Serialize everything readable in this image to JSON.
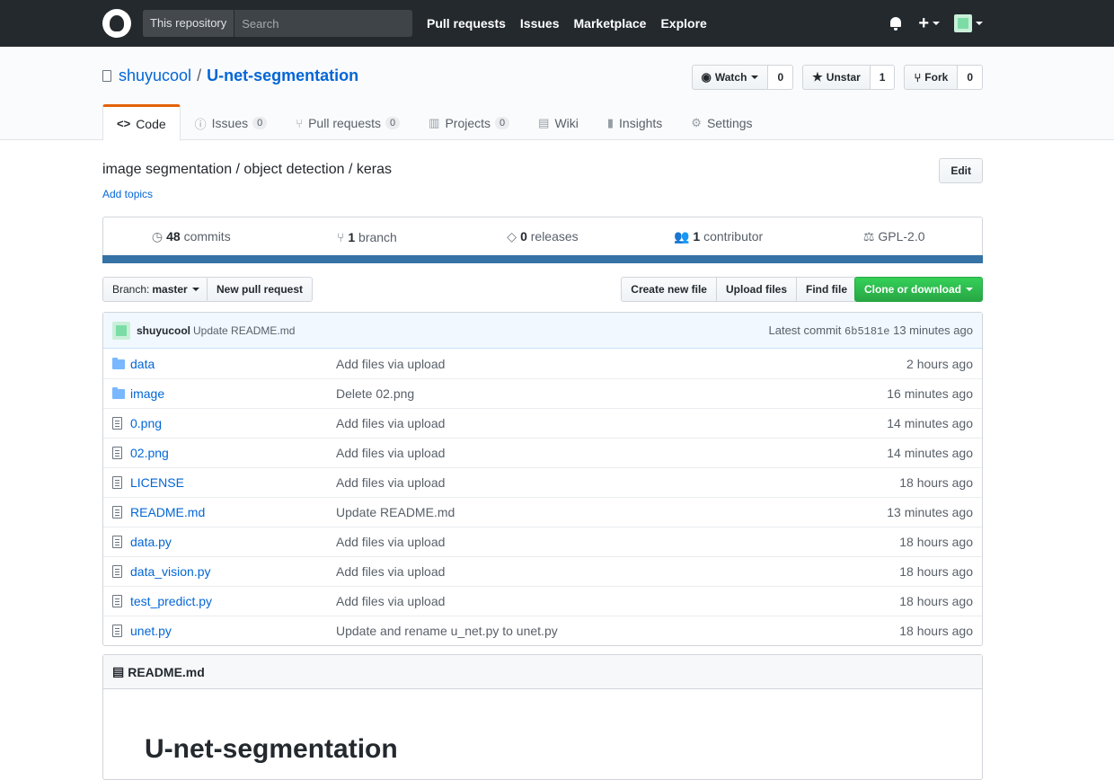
{
  "header": {
    "search_scope": "This repository",
    "search_placeholder": "Search",
    "nav": [
      "Pull requests",
      "Issues",
      "Marketplace",
      "Explore"
    ],
    "plus": "+"
  },
  "repo": {
    "owner": "shuyucool",
    "separator": "/",
    "name": "U-net-segmentation",
    "watch_label": "Watch",
    "watch_count": "0",
    "star_label": "Unstar",
    "star_count": "1",
    "fork_label": "Fork",
    "fork_count": "0"
  },
  "tabs": [
    {
      "label": "Code",
      "icon": "<>",
      "badge": ""
    },
    {
      "label": "Issues",
      "icon": "ⓘ",
      "badge": "0"
    },
    {
      "label": "Pull requests",
      "icon": "⑂",
      "badge": "0"
    },
    {
      "label": "Projects",
      "icon": "▥",
      "badge": "0"
    },
    {
      "label": "Wiki",
      "icon": "▤",
      "badge": ""
    },
    {
      "label": "Insights",
      "icon": "▮",
      "badge": ""
    },
    {
      "label": "Settings",
      "icon": "⚙",
      "badge": ""
    }
  ],
  "description": "image segmentation / object detection / keras",
  "add_topics": "Add topics",
  "edit_label": "Edit",
  "summary": {
    "commits_num": "48",
    "commits_label": "commits",
    "branch_num": "1",
    "branch_label": "branch",
    "releases_num": "0",
    "releases_label": "releases",
    "contrib_num": "1",
    "contrib_label": "contributor",
    "license": "GPL-2.0",
    "language_color": "#3572a5"
  },
  "filenav": {
    "branch_prefix": "Branch:",
    "branch_name": "master",
    "new_pr": "New pull request",
    "create_file": "Create new file",
    "upload_files": "Upload files",
    "find_file": "Find file",
    "clone": "Clone or download"
  },
  "commit": {
    "author": "shuyucool",
    "message": "Update README.md",
    "latest_label": "Latest commit",
    "sha": "6b5181e",
    "age": "13 minutes ago"
  },
  "files": [
    {
      "type": "dir",
      "name": "data",
      "message": "Add files via upload",
      "age": "2 hours ago"
    },
    {
      "type": "dir",
      "name": "image",
      "message": "Delete 02.png",
      "age": "16 minutes ago"
    },
    {
      "type": "file",
      "name": "0.png",
      "message": "Add files via upload",
      "age": "14 minutes ago"
    },
    {
      "type": "file",
      "name": "02.png",
      "message": "Add files via upload",
      "age": "14 minutes ago"
    },
    {
      "type": "file",
      "name": "LICENSE",
      "message": "Add files via upload",
      "age": "18 hours ago"
    },
    {
      "type": "file",
      "name": "README.md",
      "message": "Update README.md",
      "age": "13 minutes ago"
    },
    {
      "type": "file",
      "name": "data.py",
      "message": "Add files via upload",
      "age": "18 hours ago"
    },
    {
      "type": "file",
      "name": "data_vision.py",
      "message": "Add files via upload",
      "age": "18 hours ago"
    },
    {
      "type": "file",
      "name": "test_predict.py",
      "message": "Add files via upload",
      "age": "18 hours ago"
    },
    {
      "type": "file",
      "name": "unet.py",
      "message": "Update and rename u_net.py to unet.py",
      "age": "18 hours ago"
    }
  ],
  "readme": {
    "filename": "README.md",
    "title": "U-net-segmentation"
  }
}
